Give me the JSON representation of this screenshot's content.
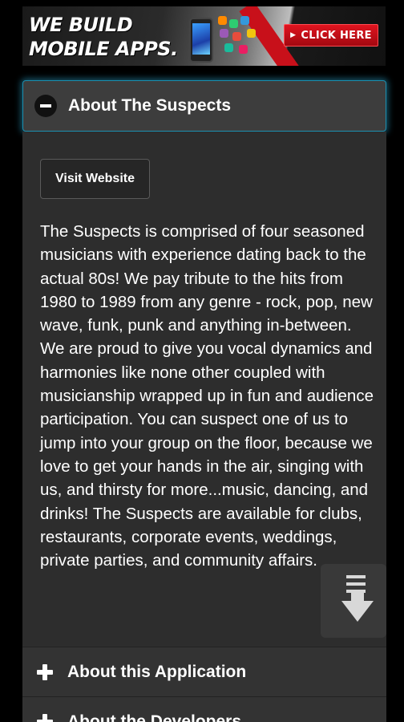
{
  "banner": {
    "headline": "WE BUILD MOBILE APPS.",
    "cta_label": "CLICK HERE",
    "accent_color": "#c8101a"
  },
  "accordion": {
    "active_section": {
      "title": "About The Suspects",
      "icon": "minus-circle-icon",
      "visit_button_label": "Visit Website",
      "description": "The Suspects is comprised of four seasoned musicians with experience dating back to the actual 80s! We pay tribute to the hits from 1980 to 1989 from any genre - rock, pop, new wave, funk, punk and anything in-between. We are proud to give you vocal dynamics and harmonies like none other coupled with musicianship wrapped up in fun and audience participation. You can suspect one of us to jump into your group on the floor, because we love to get your hands in the air, singing with us, and thirsty for more...music, dancing, and drinks! The Suspects are available for clubs, restaurants, corporate events, weddings, private parties, and community affairs."
    },
    "collapsed_sections": [
      {
        "title": "About this Application",
        "icon": "plus-icon"
      },
      {
        "title": "About the Developers",
        "icon": "plus-icon"
      }
    ]
  },
  "scroll_button": {
    "icon": "scroll-down-icon"
  }
}
